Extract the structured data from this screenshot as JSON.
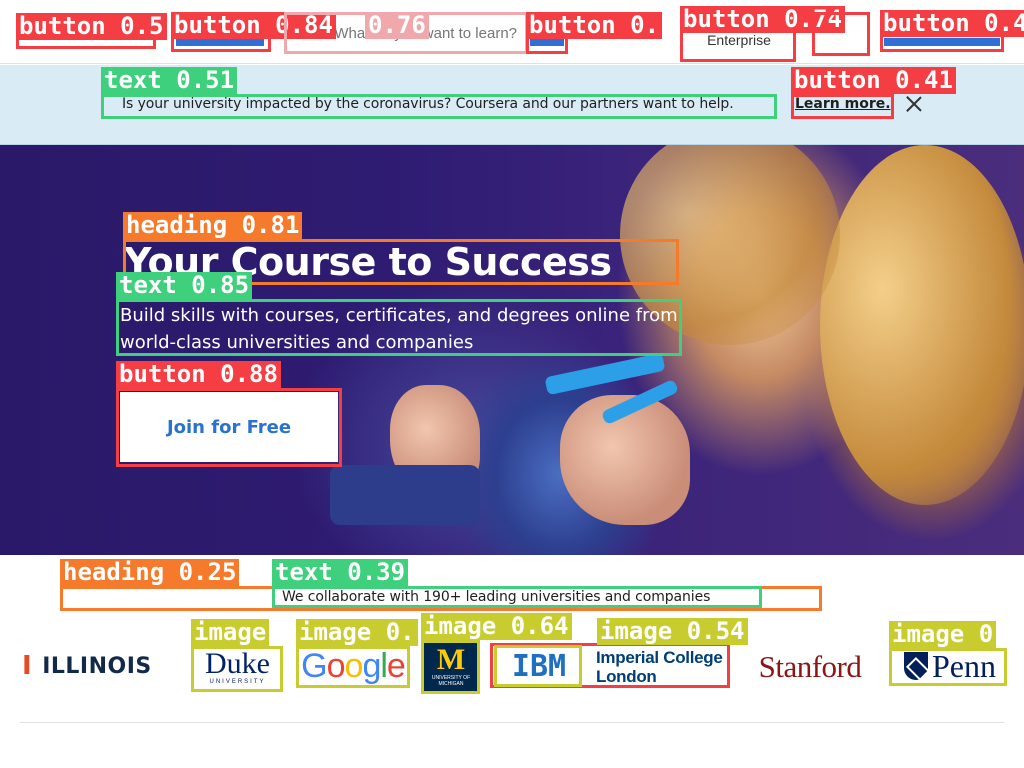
{
  "header": {
    "search_placeholder": "What do you want to learn?",
    "enterprise_label": "Enterprise"
  },
  "banner": {
    "message": "Is your university impacted by the coronavirus? Coursera and our partners want to help.",
    "link_label": "Learn more."
  },
  "hero": {
    "title": "Your Course to Success",
    "subtitle": "Build skills with courses, certificates, and degrees online from world-class universities and companies",
    "cta_label": "Join for Free"
  },
  "partners": {
    "heading": "We collaborate with 190+ leading universities and companies",
    "logos": {
      "illinois": "ILLINOIS",
      "duke": "Duke",
      "duke_sub": "UNIVERSITY",
      "google": "Google",
      "michigan": "M",
      "michigan_sub": "UNIVERSITY OF MICHIGAN",
      "ibm": "IBM",
      "imperial_line1": "Imperial College",
      "imperial_line2": "London",
      "stanford": "Stanford",
      "penn": "Penn"
    }
  },
  "detections": [
    {
      "label": "button 0.5"
    },
    {
      "label": "button 0.84"
    },
    {
      "label": "0.76"
    },
    {
      "label": "button 0."
    },
    {
      "label": "button 0.74"
    },
    {
      "label": "button 0.4"
    },
    {
      "label": "text 0.51"
    },
    {
      "label": "button 0.41"
    },
    {
      "label": "heading 0.81"
    },
    {
      "label": "text 0.85"
    },
    {
      "label": "button 0.88"
    },
    {
      "label": "heading 0.25"
    },
    {
      "label": "text 0.39"
    },
    {
      "label": "image"
    },
    {
      "label": "image 0."
    },
    {
      "label": "image 0.64"
    },
    {
      "label": "image 0.54"
    },
    {
      "label": "image 0"
    }
  ],
  "colors": {
    "button_box": "#f43e44",
    "text_box": "#3ed07c",
    "heading_box": "#f67a2c",
    "image_box": "#c8cc2e",
    "hero_bg": "#2f1c73",
    "banner_bg": "#d9ecf6",
    "cta_text": "#2a73cc"
  }
}
